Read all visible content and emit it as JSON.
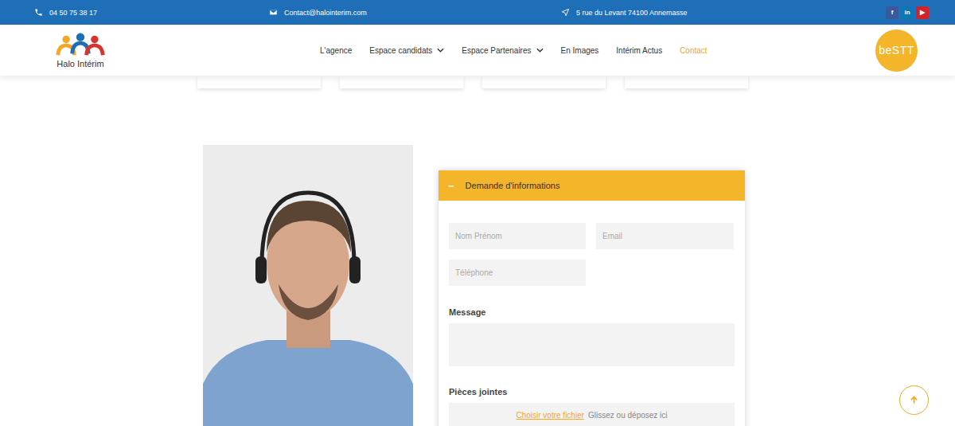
{
  "topbar": {
    "phone": "04 50 75 38 17",
    "email": "Contact@halointerim.com",
    "address": "5 rue du Levant 74100 Annemasse",
    "social": [
      {
        "name": "facebook",
        "label": "f",
        "color": "#3b5998"
      },
      {
        "name": "linkedin",
        "label": "in",
        "color": "#0a78b5"
      },
      {
        "name": "youtube",
        "label": "▶",
        "color": "#d3222a"
      }
    ]
  },
  "logo": {
    "text": "Halo Intérim"
  },
  "nav": [
    {
      "label": "L'agence",
      "dropdown": false,
      "selected": false
    },
    {
      "label": "Espace candidats",
      "dropdown": true,
      "selected": false
    },
    {
      "label": "Espace Partenaires",
      "dropdown": true,
      "selected": false
    },
    {
      "label": "En Images",
      "dropdown": false,
      "selected": false
    },
    {
      "label": "Intérim Actus",
      "dropdown": false,
      "selected": false
    },
    {
      "label": "Contact",
      "dropdown": false,
      "selected": true
    }
  ],
  "badge": {
    "text": "beSTT"
  },
  "form": {
    "title": "Demande d'informations",
    "toggle": "−",
    "expanded": true,
    "fields": [
      {
        "placeholder": "Nom Prénom"
      },
      {
        "placeholder": "Email"
      },
      {
        "placeholder": "Téléphone"
      }
    ],
    "message_label": "Message",
    "attachments_label": "Pièces jointes",
    "upload_link": "Choisir votre fichier",
    "upload_hint": "Glissez ou déposez ici"
  }
}
